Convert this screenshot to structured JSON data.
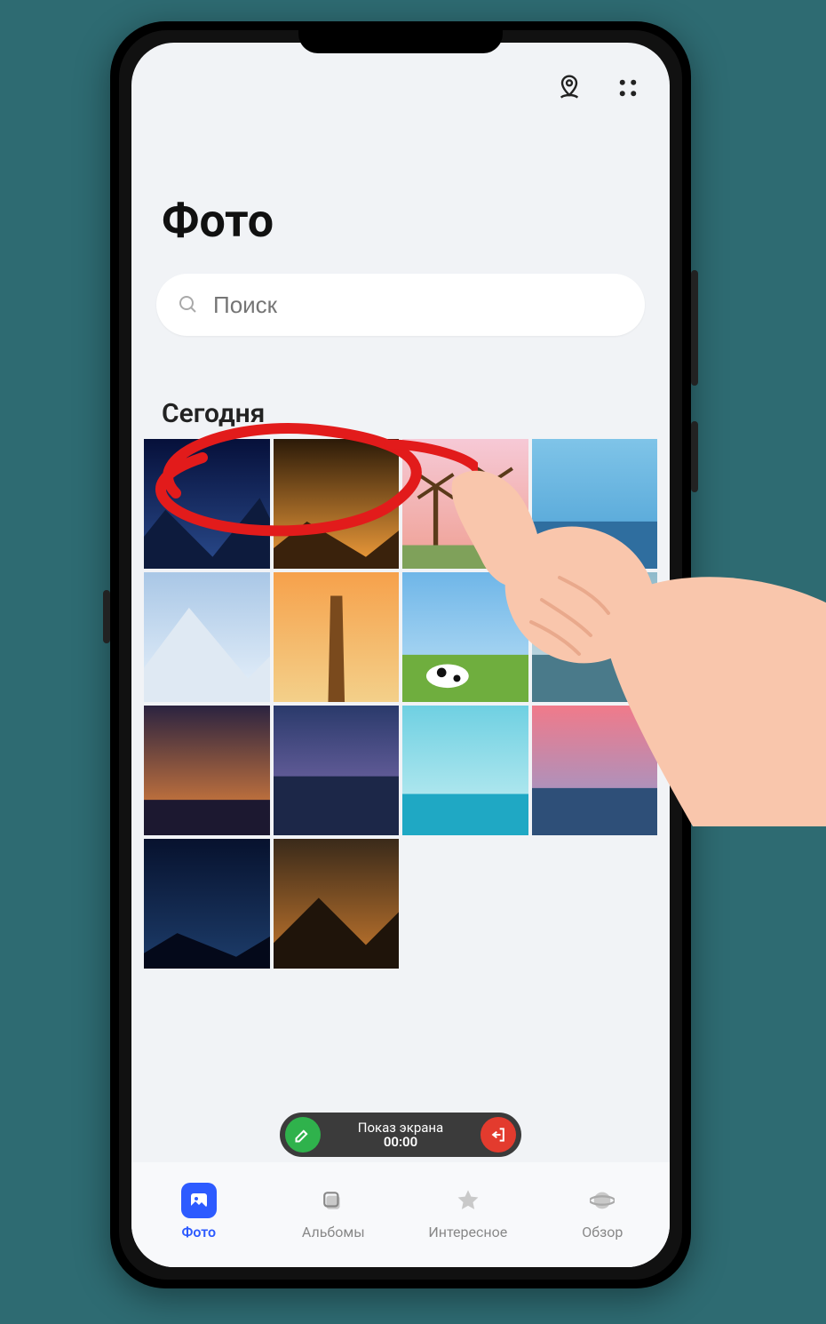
{
  "header": {
    "title": "Фото"
  },
  "search": {
    "placeholder": "Поиск"
  },
  "section": {
    "today": "Сегодня"
  },
  "pill": {
    "line1": "Показ экрана",
    "line2": "00:00"
  },
  "nav": {
    "photos": {
      "label": "Фото"
    },
    "albums": {
      "label": "Альбомы"
    },
    "interest": {
      "label": "Интересное"
    },
    "browse": {
      "label": "Обзор"
    }
  },
  "thumbs": [
    {
      "id": "mountain-night"
    },
    {
      "id": "sunset-hills"
    },
    {
      "id": "windmills"
    },
    {
      "id": "harbor-town"
    },
    {
      "id": "snow-peak"
    },
    {
      "id": "obelisk-sunset"
    },
    {
      "id": "cow-field"
    },
    {
      "id": "river-boat"
    },
    {
      "id": "clouds-sunset"
    },
    {
      "id": "castle-dusk"
    },
    {
      "id": "over-water-huts"
    },
    {
      "id": "lagoon-cliffs"
    },
    {
      "id": "rocky-shore-night"
    },
    {
      "id": "lake-reflection"
    }
  ]
}
